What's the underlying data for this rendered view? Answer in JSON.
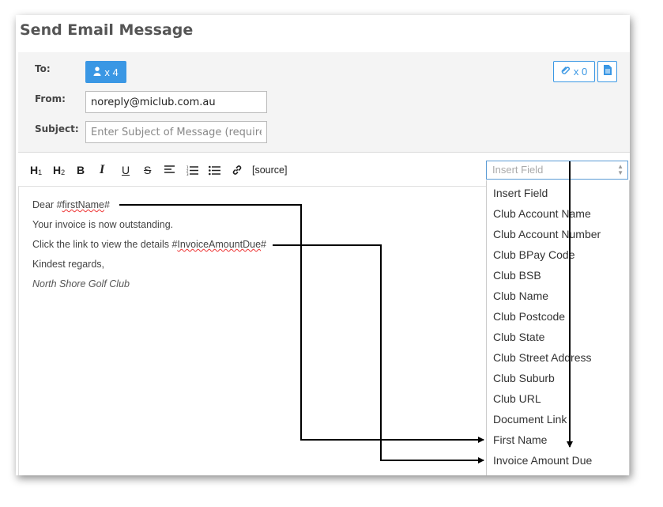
{
  "title": "Send Email Message",
  "to": {
    "label": "To:",
    "count": "x 4"
  },
  "from": {
    "label": "From:",
    "value": "noreply@miclub.com.au"
  },
  "subject": {
    "label": "Subject:",
    "placeholder": "Enter Subject of Message (required)"
  },
  "attachments": {
    "count": "x 0"
  },
  "toolbar": {
    "source": "[source]"
  },
  "insert_field": {
    "placeholder": "Insert Field",
    "options": [
      "Insert Field",
      "Club Account Name",
      "Club Account Number",
      "Club BPay Code",
      "Club BSB",
      "Club Name",
      "Club Postcode",
      "Club State",
      "Club Street Address",
      "Club Suburb",
      "Club URL",
      "Document Link",
      "First Name",
      "Invoice Amount Due"
    ]
  },
  "body": {
    "greeting_prefix": "Dear #",
    "greeting_field": "firstName",
    "greeting_suffix": "#",
    "line2": "Your invoice is now outstanding.",
    "line3_prefix": "Click the link to view the details #",
    "line3_field": "InvoiceAmountDue",
    "line3_suffix": "#",
    "line4": "Kindest regards,",
    "signature": "North Shore Golf Club"
  },
  "colors": {
    "accent": "#3a97e4",
    "header_bg": "#f4f4f4"
  }
}
